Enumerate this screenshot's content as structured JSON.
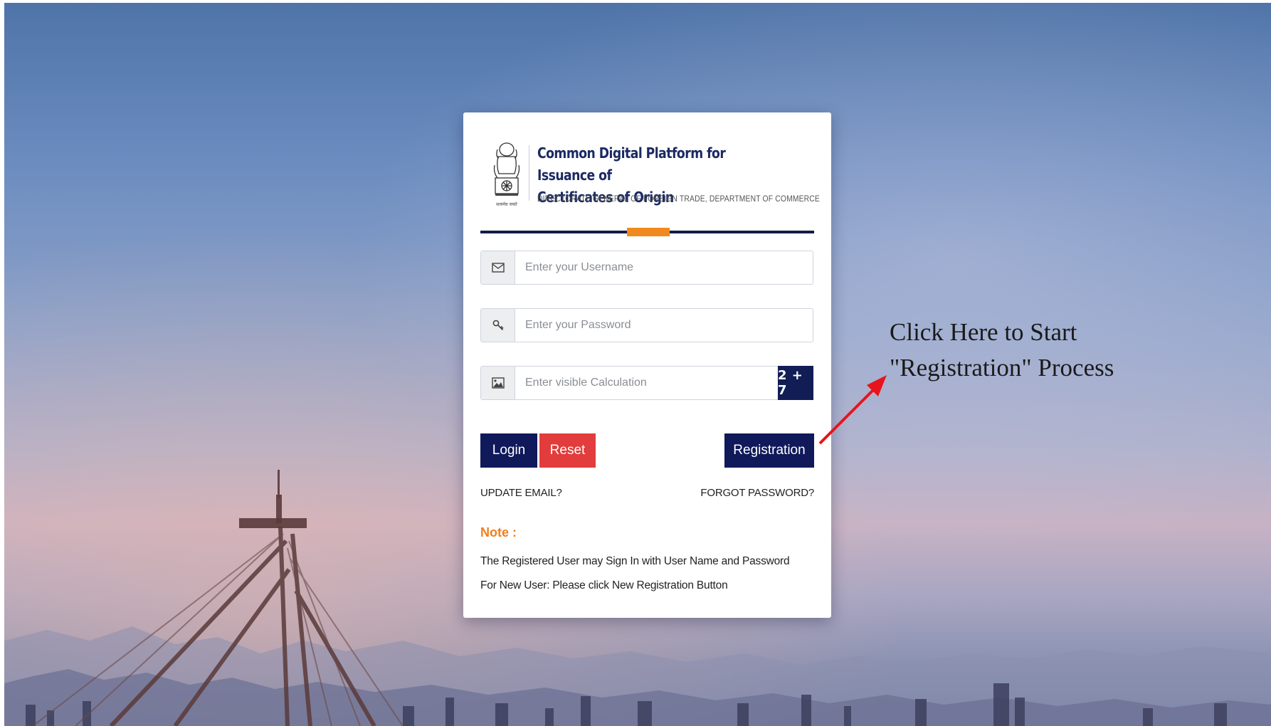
{
  "header": {
    "title_line1": "Common Digital Platform for Issuance of",
    "title_line2": "Certificates of Origin",
    "subtitle": "DIRECTORATE GENERAL OF FOREIGN TRADE, DEPARTMENT OF COMMERCE",
    "emblem_caption": "सत्यमेव जयते"
  },
  "form": {
    "username": {
      "placeholder": "Enter your Username",
      "value": "",
      "icon": "envelope-icon"
    },
    "password": {
      "placeholder": "Enter your Password",
      "value": "",
      "icon": "key-icon"
    },
    "captcha": {
      "placeholder": "Enter visible Calculation",
      "value": "",
      "icon": "image-icon",
      "expression": "2 + 7"
    }
  },
  "buttons": {
    "login": "Login",
    "reset": "Reset",
    "registration": "Registration"
  },
  "links": {
    "update_email": "UPDATE EMAIL?",
    "forgot_password": "FORGOT PASSWORD?"
  },
  "note": {
    "label": "Note :",
    "lines": [
      "The Registered User may Sign In with User Name and Password",
      "For New User: Please click New Registration Button"
    ]
  },
  "annotation": {
    "line1": "Click Here to Start",
    "line2": "\"Registration\" Process"
  },
  "colors": {
    "navy": "#10195a",
    "reset_red": "#e23c3c",
    "accent_orange": "#f18a1c",
    "arrow_red": "#e8141b"
  }
}
